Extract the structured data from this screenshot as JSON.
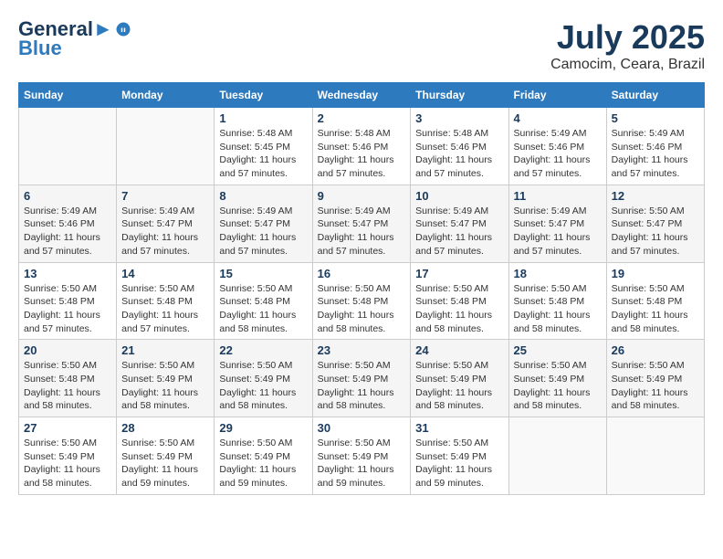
{
  "header": {
    "logo_line1": "General",
    "logo_line2": "Blue",
    "month": "July 2025",
    "location": "Camocim, Ceara, Brazil"
  },
  "days_of_week": [
    "Sunday",
    "Monday",
    "Tuesday",
    "Wednesday",
    "Thursday",
    "Friday",
    "Saturday"
  ],
  "weeks": [
    [
      {
        "day": "",
        "info": ""
      },
      {
        "day": "",
        "info": ""
      },
      {
        "day": "1",
        "info": "Sunrise: 5:48 AM\nSunset: 5:45 PM\nDaylight: 11 hours and 57 minutes."
      },
      {
        "day": "2",
        "info": "Sunrise: 5:48 AM\nSunset: 5:46 PM\nDaylight: 11 hours and 57 minutes."
      },
      {
        "day": "3",
        "info": "Sunrise: 5:48 AM\nSunset: 5:46 PM\nDaylight: 11 hours and 57 minutes."
      },
      {
        "day": "4",
        "info": "Sunrise: 5:49 AM\nSunset: 5:46 PM\nDaylight: 11 hours and 57 minutes."
      },
      {
        "day": "5",
        "info": "Sunrise: 5:49 AM\nSunset: 5:46 PM\nDaylight: 11 hours and 57 minutes."
      }
    ],
    [
      {
        "day": "6",
        "info": "Sunrise: 5:49 AM\nSunset: 5:46 PM\nDaylight: 11 hours and 57 minutes."
      },
      {
        "day": "7",
        "info": "Sunrise: 5:49 AM\nSunset: 5:47 PM\nDaylight: 11 hours and 57 minutes."
      },
      {
        "day": "8",
        "info": "Sunrise: 5:49 AM\nSunset: 5:47 PM\nDaylight: 11 hours and 57 minutes."
      },
      {
        "day": "9",
        "info": "Sunrise: 5:49 AM\nSunset: 5:47 PM\nDaylight: 11 hours and 57 minutes."
      },
      {
        "day": "10",
        "info": "Sunrise: 5:49 AM\nSunset: 5:47 PM\nDaylight: 11 hours and 57 minutes."
      },
      {
        "day": "11",
        "info": "Sunrise: 5:49 AM\nSunset: 5:47 PM\nDaylight: 11 hours and 57 minutes."
      },
      {
        "day": "12",
        "info": "Sunrise: 5:50 AM\nSunset: 5:47 PM\nDaylight: 11 hours and 57 minutes."
      }
    ],
    [
      {
        "day": "13",
        "info": "Sunrise: 5:50 AM\nSunset: 5:48 PM\nDaylight: 11 hours and 57 minutes."
      },
      {
        "day": "14",
        "info": "Sunrise: 5:50 AM\nSunset: 5:48 PM\nDaylight: 11 hours and 57 minutes."
      },
      {
        "day": "15",
        "info": "Sunrise: 5:50 AM\nSunset: 5:48 PM\nDaylight: 11 hours and 58 minutes."
      },
      {
        "day": "16",
        "info": "Sunrise: 5:50 AM\nSunset: 5:48 PM\nDaylight: 11 hours and 58 minutes."
      },
      {
        "day": "17",
        "info": "Sunrise: 5:50 AM\nSunset: 5:48 PM\nDaylight: 11 hours and 58 minutes."
      },
      {
        "day": "18",
        "info": "Sunrise: 5:50 AM\nSunset: 5:48 PM\nDaylight: 11 hours and 58 minutes."
      },
      {
        "day": "19",
        "info": "Sunrise: 5:50 AM\nSunset: 5:48 PM\nDaylight: 11 hours and 58 minutes."
      }
    ],
    [
      {
        "day": "20",
        "info": "Sunrise: 5:50 AM\nSunset: 5:48 PM\nDaylight: 11 hours and 58 minutes."
      },
      {
        "day": "21",
        "info": "Sunrise: 5:50 AM\nSunset: 5:49 PM\nDaylight: 11 hours and 58 minutes."
      },
      {
        "day": "22",
        "info": "Sunrise: 5:50 AM\nSunset: 5:49 PM\nDaylight: 11 hours and 58 minutes."
      },
      {
        "day": "23",
        "info": "Sunrise: 5:50 AM\nSunset: 5:49 PM\nDaylight: 11 hours and 58 minutes."
      },
      {
        "day": "24",
        "info": "Sunrise: 5:50 AM\nSunset: 5:49 PM\nDaylight: 11 hours and 58 minutes."
      },
      {
        "day": "25",
        "info": "Sunrise: 5:50 AM\nSunset: 5:49 PM\nDaylight: 11 hours and 58 minutes."
      },
      {
        "day": "26",
        "info": "Sunrise: 5:50 AM\nSunset: 5:49 PM\nDaylight: 11 hours and 58 minutes."
      }
    ],
    [
      {
        "day": "27",
        "info": "Sunrise: 5:50 AM\nSunset: 5:49 PM\nDaylight: 11 hours and 58 minutes."
      },
      {
        "day": "28",
        "info": "Sunrise: 5:50 AM\nSunset: 5:49 PM\nDaylight: 11 hours and 59 minutes."
      },
      {
        "day": "29",
        "info": "Sunrise: 5:50 AM\nSunset: 5:49 PM\nDaylight: 11 hours and 59 minutes."
      },
      {
        "day": "30",
        "info": "Sunrise: 5:50 AM\nSunset: 5:49 PM\nDaylight: 11 hours and 59 minutes."
      },
      {
        "day": "31",
        "info": "Sunrise: 5:50 AM\nSunset: 5:49 PM\nDaylight: 11 hours and 59 minutes."
      },
      {
        "day": "",
        "info": ""
      },
      {
        "day": "",
        "info": ""
      }
    ]
  ]
}
